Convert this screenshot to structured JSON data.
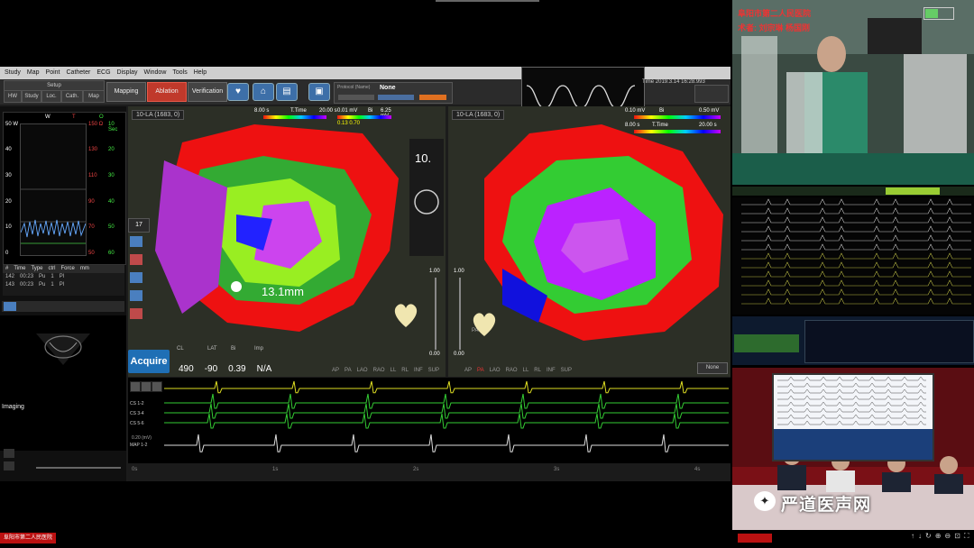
{
  "menu": [
    "Study",
    "Map",
    "Point",
    "Catheter",
    "ECG",
    "Display",
    "Window",
    "Tools",
    "Help"
  ],
  "toolbar": {
    "setup_label": "Setup",
    "sub_tabs": [
      "HW",
      "Study",
      "Loc.",
      "Cath.",
      "Map"
    ],
    "modes": [
      "Mapping",
      "Ablation",
      "Verification"
    ],
    "protocol_label": "Protocol (Name)",
    "protocol_value": "None",
    "time": "Time 2019.3.14 16:28.993"
  },
  "rate_panel": {
    "w_label": "W",
    "t_label": "T",
    "o_label": "O",
    "left_axis": [
      "50 W",
      "40",
      "30",
      "20",
      "10",
      "0"
    ],
    "mid_axis": [
      "50 °C",
      "40",
      "30",
      "20",
      "10",
      "0"
    ],
    "right_axis": [
      "150 Ω",
      "130",
      "110",
      "90",
      "70",
      "50"
    ],
    "right2_axis": [
      "10 Sec",
      "20",
      "30",
      "40",
      "50",
      "60"
    ],
    "x_ticks": [
      "0",
      "2",
      "4",
      "6",
      "8",
      "10 Sec"
    ],
    "table_headers": [
      "#",
      "Time",
      "Type",
      "ctrl",
      "Force",
      "mm"
    ],
    "table_rows": [
      [
        "142",
        "00:23",
        "Pu",
        "1",
        "Pl"
      ],
      [
        "143",
        "00:23",
        "Pu",
        "1",
        "Pl"
      ]
    ]
  },
  "echo": {
    "label": "Imaging"
  },
  "map1": {
    "title": "10-LA (1683, 0)",
    "time_range_left": "8.00 s",
    "time_label": "T.Time",
    "time_range_right": "20.00 s",
    "bi_low": "0.01 mV",
    "bi_label": "Bi",
    "bi_high": "6.25 mV",
    "bi_vals": "0.13  0.70",
    "distance": "13.1mm",
    "big_num": "10.",
    "slider_top": "1.00",
    "slider_bottom": "0.00"
  },
  "map2": {
    "title": "10-LA (1683, 0)",
    "bi_low": "0.10 mV",
    "bi_label": "Bi",
    "bi_high": "0.50 mV",
    "time_range_left": "8.00 s",
    "time_label": "T.Time",
    "time_range_right": "20.00 s",
    "slider_top": "1.00",
    "slider_bottom": "0.00",
    "view_label": "None",
    "pa_label": "PA"
  },
  "views": [
    "AP",
    "PA",
    "LAO",
    "RAO",
    "LL",
    "RL",
    "INF",
    "SUP"
  ],
  "acquire": "Acquire",
  "measurements": {
    "headers": [
      "CL",
      "LAT",
      "Bi",
      "Imp"
    ],
    "values": [
      "490",
      "-90",
      "0.39",
      "N/A"
    ],
    "spin_value": "17"
  },
  "ecg": {
    "channels": [
      "CS 1-2",
      "CS 3-4",
      "CS 5-6",
      "MAP 1-2"
    ],
    "time_ticks": [
      "0s",
      "1s",
      "2s",
      "3s",
      "4s"
    ],
    "mv_label": "0.20 (mV)"
  },
  "video": {
    "caption1": "阜阳市第二人民医院",
    "caption2": "术者: 刘宗琳 杨国刚",
    "watermark": "严道医声网",
    "bottom_left": "阜阳市第二人民医院"
  },
  "colors": {
    "ablation_active": "#c0392b",
    "acquire": "#1f6fb5",
    "brand_red": "#b11"
  }
}
